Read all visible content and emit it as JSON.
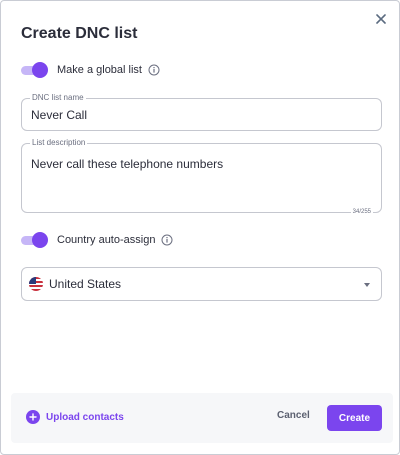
{
  "dialog": {
    "title": "Create DNC list",
    "close_icon": "close-icon"
  },
  "global_toggle": {
    "label": "Make a global list",
    "on": true,
    "info_icon": "info-icon"
  },
  "name_field": {
    "label": "DNC list name",
    "value": "Never Call"
  },
  "description_field": {
    "label": "List description",
    "value": "Never call these telephone numbers",
    "counter": "34/255"
  },
  "country_toggle": {
    "label": "Country auto-assign",
    "on": true,
    "info_icon": "info-icon"
  },
  "country_select": {
    "value": "United States",
    "flag_icon": "us-flag-icon",
    "caret_icon": "caret-down-icon"
  },
  "footer": {
    "upload_label": "Upload contacts",
    "cancel_label": "Cancel",
    "create_label": "Create"
  },
  "colors": {
    "accent": "#7b45ee",
    "accent_light": "#c6b6f7",
    "text": "#2b2d3a",
    "muted": "#6b6f80",
    "footer_bg": "#f6f7f9"
  }
}
